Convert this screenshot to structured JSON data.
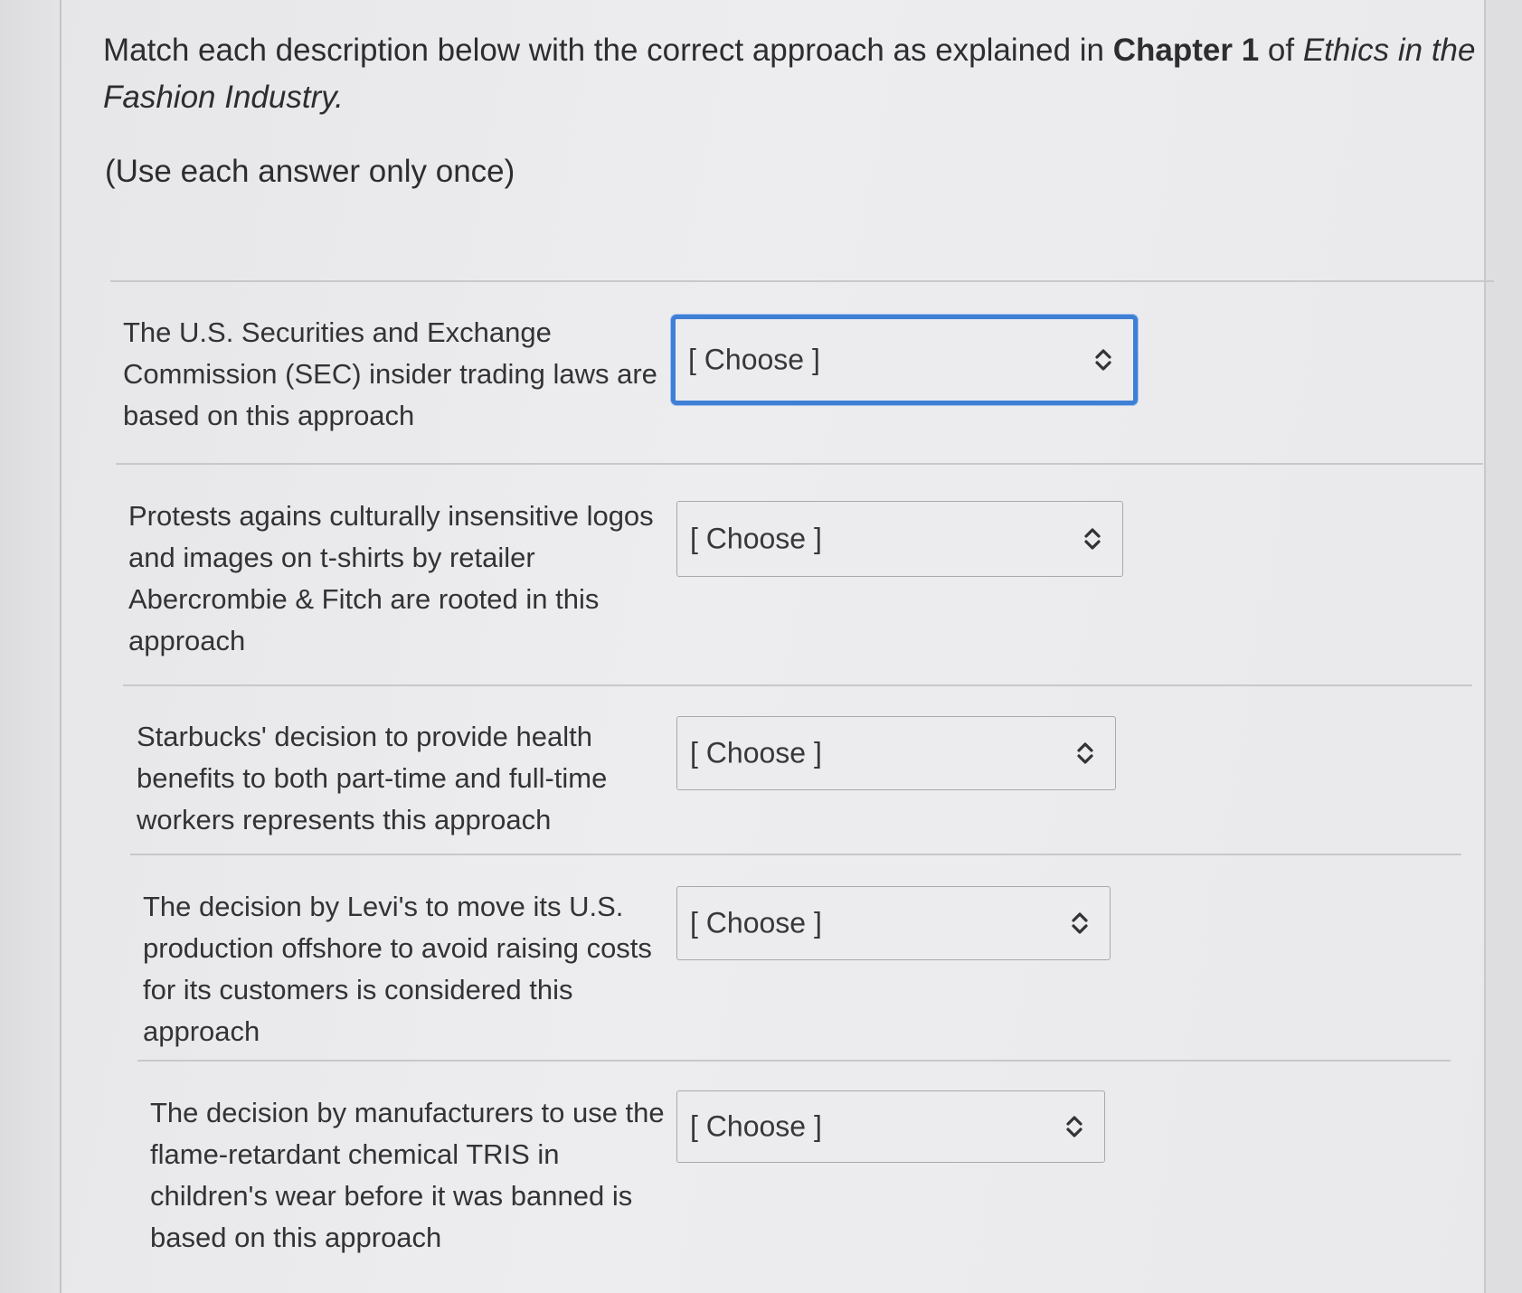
{
  "prompt": {
    "text_before_bold": "Match each description below with the correct approach as explained in ",
    "bold_text": "Chapter 1",
    "text_between": " of ",
    "italic_text": "Ethics in the Fashion Industry."
  },
  "instruction": "(Use each answer only once)",
  "questions": [
    {
      "text": "The U.S. Securities and Exchange Commission (SEC) insider trading laws are based on this approach",
      "select_value": "[ Choose ]"
    },
    {
      "text": "Protests agains culturally insensitive logos and images on t-shirts by retailer Abercrombie & Fitch are rooted in this approach",
      "select_value": "[ Choose ]"
    },
    {
      "text": "Starbucks' decision to provide health benefits to both part-time and full-time workers represents this approach",
      "select_value": "[ Choose ]"
    },
    {
      "text": "The decision by Levi's to move its U.S. production offshore to avoid raising costs for its customers is considered this approach",
      "select_value": "[ Choose ]"
    },
    {
      "text": "The decision by manufacturers to use the flame-retardant chemical TRIS in children's wear before it was banned is based on this approach",
      "select_value": "[ Choose ]"
    }
  ],
  "icons": {
    "select_indicator": "chevron-up-down-icon"
  },
  "colors": {
    "focus_ring": "#3f7fd6",
    "text": "#2e2e30"
  }
}
